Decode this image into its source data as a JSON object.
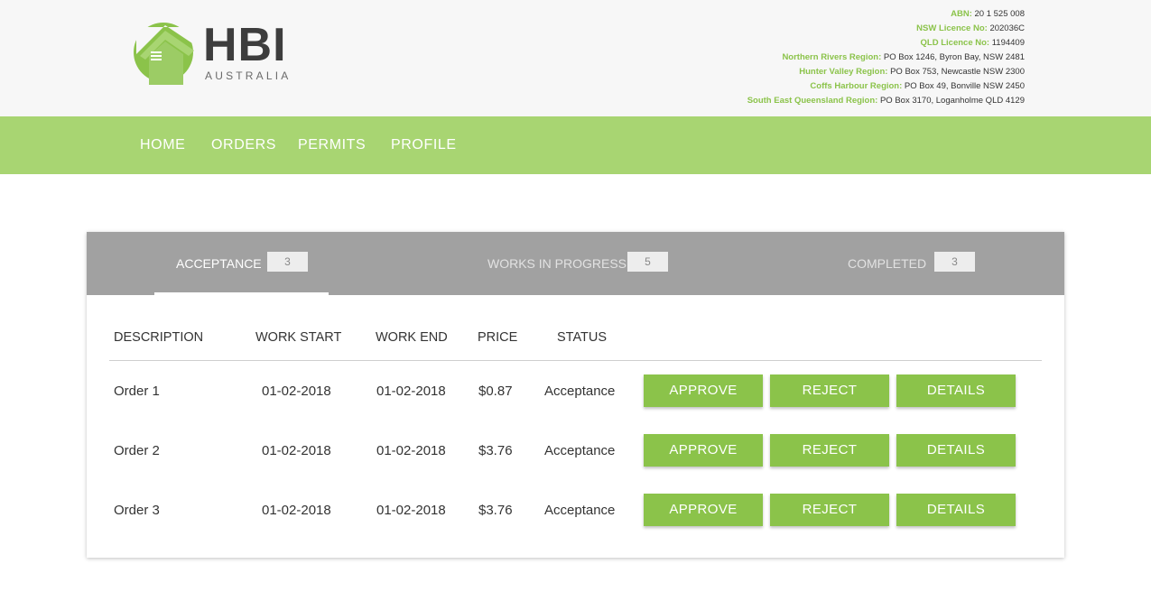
{
  "brand": {
    "name": "HBI",
    "subtitle": "AUSTRALIA",
    "colors": {
      "green": "#8bc34a",
      "nav_green": "#a8d572",
      "tab_gray": "#a1a1a1"
    }
  },
  "contact": {
    "abn_label": "ABN:",
    "abn": "20 1 525 008",
    "nsw_label": "NSW Licence No:",
    "nsw": "202036C",
    "qld_label": "QLD Licence No:",
    "qld": "1194409",
    "nr_label": "Northern Rivers Region:",
    "nr": "PO Box 1246, Byron Bay, NSW 2481",
    "hv_label": "Hunter Valley Region:",
    "hv": "PO Box 753, Newcastle NSW 2300",
    "ch_label": "Coffs Harbour Region:",
    "ch": "PO Box 49, Bonville NSW 2450",
    "seq_label": "South East Queensland Region:",
    "seq": "PO Box 3170, Loganholme QLD 4129"
  },
  "nav": {
    "home": "HOME",
    "orders": "ORDERS",
    "permits": "PERMITS",
    "profile": "PROFILE"
  },
  "tabs": [
    {
      "label": "ACCEPTANCE",
      "count": "3",
      "active": true
    },
    {
      "label": "WORKS IN PROGRESS",
      "count": "5",
      "active": false
    },
    {
      "label": "COMPLETED",
      "count": "3",
      "active": false
    }
  ],
  "table": {
    "headers": {
      "description": "DESCRIPTION",
      "start": "WORK START",
      "end": "WORK END",
      "price": "PRICE",
      "status": "STATUS"
    },
    "rows": [
      {
        "description": "Order 1",
        "start": "01-02-2018",
        "end": "01-02-2018",
        "price": "$0.87",
        "status": "Acceptance"
      },
      {
        "description": "Order 2",
        "start": "01-02-2018",
        "end": "01-02-2018",
        "price": "$3.76",
        "status": "Acceptance"
      },
      {
        "description": "Order 3",
        "start": "01-02-2018",
        "end": "01-02-2018",
        "price": "$3.76",
        "status": "Acceptance"
      }
    ],
    "actions": {
      "approve": "APPROVE",
      "reject": "REJECT",
      "details": "DETAILS"
    }
  }
}
